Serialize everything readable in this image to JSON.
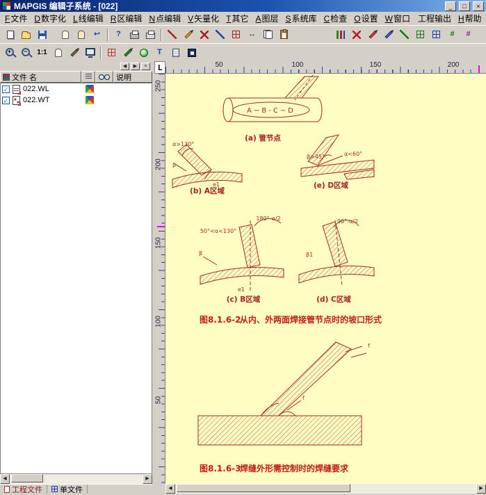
{
  "window": {
    "title": "MAPGIS 编辑子系统 - [022]"
  },
  "glyphs": {
    "minimize": "_",
    "maximize": "□",
    "close": "×",
    "check": "✓",
    "left": "◀",
    "right": "▶",
    "plus": "+",
    "minus": "−",
    "one_one": "1:1",
    "help": "?",
    "undo": "↩",
    "hash": "#",
    "t_label": "T",
    "arrows": "↔"
  },
  "menu": {
    "items": [
      {
        "key": "F",
        "label": "文件"
      },
      {
        "key": "D",
        "label": "数字化"
      },
      {
        "key": "L",
        "label": "线编辑"
      },
      {
        "key": "R",
        "label": "区编辑"
      },
      {
        "key": "N",
        "label": "点编辑"
      },
      {
        "key": "V",
        "label": "矢量化"
      },
      {
        "key": "T",
        "label": "其它"
      },
      {
        "key": "A",
        "label": "图层"
      },
      {
        "key": "S",
        "label": "系统库"
      },
      {
        "key": "C",
        "label": "检查"
      },
      {
        "key": "O",
        "label": "设置"
      },
      {
        "key": "W",
        "label": "窗口"
      },
      {
        "key": "",
        "label": "工程输出"
      },
      {
        "key": "H",
        "label": "帮助"
      }
    ]
  },
  "toolbar_main": {
    "icons": [
      "new-file",
      "open-project",
      "save",
      "hand-tool",
      "browse-tool",
      "undo",
      "context-help",
      "print",
      "print-preview",
      "draw-polyline",
      "edit-line",
      "cut-line",
      "link-line",
      "node-edit",
      "move-tool",
      "copy",
      "paste",
      "layer-bars",
      "delete-x",
      "pencil-edit",
      "pencil-attr",
      "measure-line",
      "grid-edit-green",
      "grid-edit-blue",
      "hash-green",
      "hash-purple"
    ]
  },
  "toolbar_view": {
    "icons": [
      "zoom-in",
      "zoom-out",
      "zoom-1-1",
      "pan",
      "redraw",
      "full-screen-display",
      "update-window",
      "pencil-green",
      "browse-globe",
      "text-label",
      "note-edit",
      "app-window"
    ]
  },
  "panel": {
    "header": {
      "file_col": "文件 名",
      "desc_col": "说明"
    },
    "files": [
      {
        "name": "022.WL",
        "checked": true
      },
      {
        "name": "022.WT",
        "checked": true
      }
    ],
    "tabs": [
      {
        "label": "工程文件"
      },
      {
        "label": "单文件"
      }
    ]
  },
  "rulers": {
    "corner": "L",
    "h": [
      "50",
      "100",
      "150",
      "200"
    ],
    "v": [
      "250",
      "200",
      "150",
      "100",
      "50"
    ]
  },
  "drawing": {
    "pipe_label": "A~B-C~D",
    "fig_a_label": "(a)  管节点",
    "fig_b_label": "(b)  A区域",
    "fig_e_label": "(e)  D区域",
    "fig_c_label": "(c)  B区域",
    "fig_d_label": "(d)  C区域",
    "ann_alpha_gt": "α>130°",
    "ann_beta": "β",
    "ann_e1": "e1",
    "ann_beta_gt": "β>45°",
    "ann_alpha_lt": "α<60°",
    "ann_180": "180°-α/2",
    "ann_range": "50°<α<130°",
    "ann_90": "90°-α/2",
    "ann_beta1": "β1",
    "ann_f": "f",
    "cap1_no": "图8.1.6-2",
    "cap1_text": "从内、外两面焊接管节点时的坡口形式",
    "cap2_no": "图8.1.6-3",
    "cap2_text": "焊缝外形需控制时的焊缝要求"
  }
}
